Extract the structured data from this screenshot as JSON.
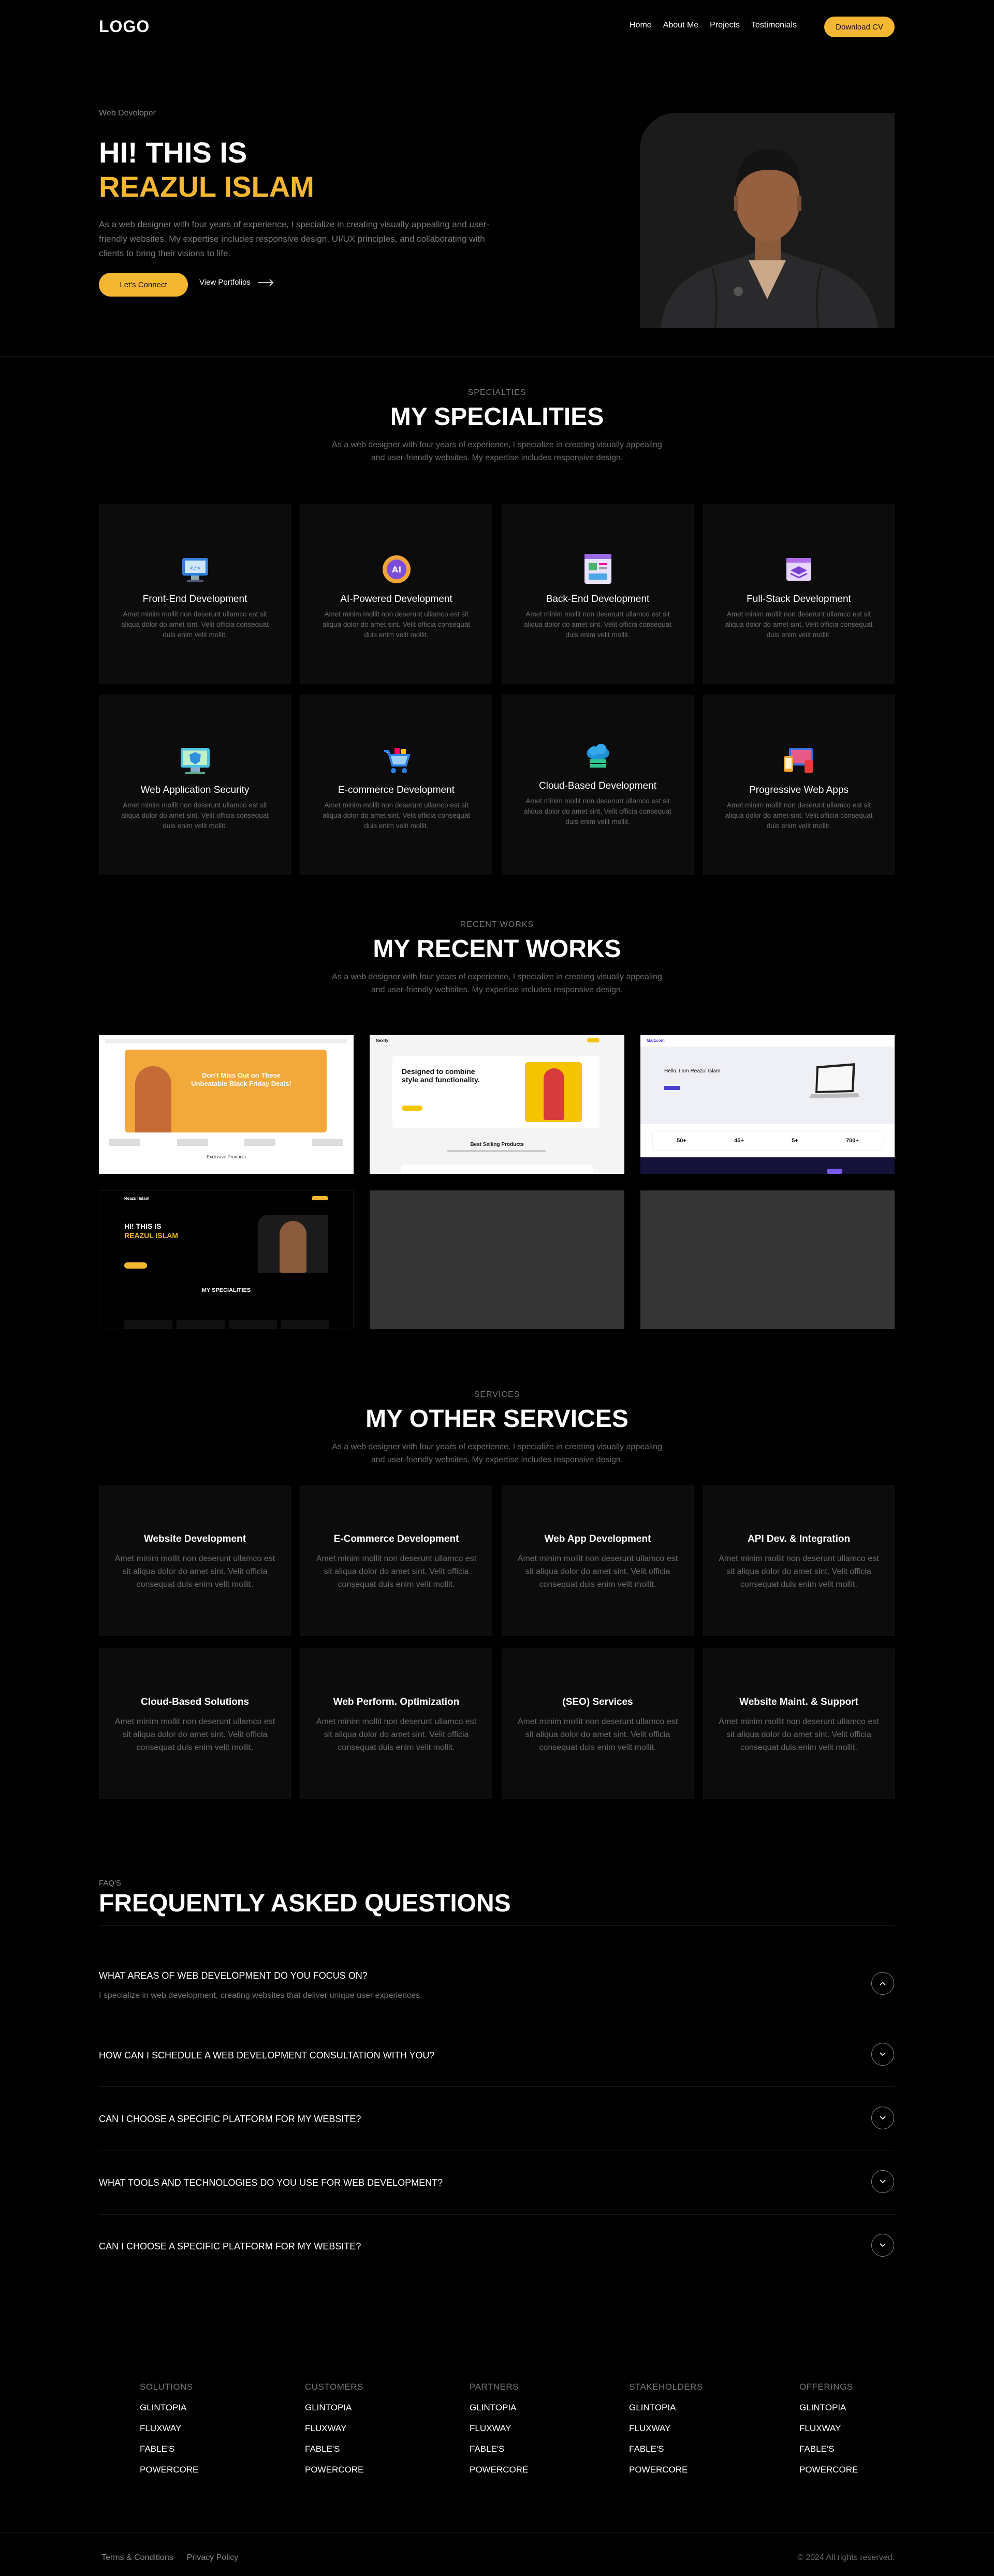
{
  "header": {
    "logo": "LOGO",
    "nav": [
      "Home",
      "About Me",
      "Projects",
      "Testimonials"
    ],
    "cta": "Download CV"
  },
  "hero": {
    "tag": "Web Developer",
    "line1": "HI! THIS IS",
    "line2": "REAZUL ISLAM",
    "desc": "As a web designer with four years of experience, I specialize in creating visually appealing and user-friendly websites. My expertise includes responsive design, UI/UX principles, and collaborating with clients to bring their visions to life.",
    "btn_connect": "Let's Connect",
    "btn_portfolio": "View Portfolios"
  },
  "specialities": {
    "tag": "SPECIALTIES",
    "title": "MY SPECIALITIES",
    "desc": "As a web designer with four years of experience, I specialize in creating visually appealing and user-friendly websites. My expertise includes responsive design.",
    "card_desc": "Amet minim mollit non deserunt ullamco est sit aliqua dolor do amet sint. Velit officia consequat duis enim velit mollit.",
    "items": [
      {
        "title": "Front-End Development",
        "icon": "monitor-code-icon"
      },
      {
        "title": "AI-Powered Development",
        "icon": "ai-chip-icon"
      },
      {
        "title": "Back-End Development",
        "icon": "server-window-icon"
      },
      {
        "title": "Full-Stack Development",
        "icon": "stack-window-icon"
      },
      {
        "title": "Web Application Security",
        "icon": "shield-monitor-icon"
      },
      {
        "title": "E-commerce Development",
        "icon": "shopping-cart-icon"
      },
      {
        "title": "Cloud-Based Development",
        "icon": "cloud-server-icon"
      },
      {
        "title": "Progressive Web Apps",
        "icon": "devices-icon"
      }
    ]
  },
  "works": {
    "tag": "RECENT WORKS",
    "title": "MY RECENT WORKS",
    "desc": "As a web designer with four years of experience, I specialize in creating visually appealing and user-friendly websites. My expertise includes responsive design.",
    "thumb1": {
      "headline": "Don't Miss Out on These Unbeatable Black Friday Deals!",
      "sub": "Exclusive Products"
    },
    "thumb2": {
      "brand": "Nexify",
      "headline": "Designed to combine style and functionality.",
      "sub": "Best Selling Products"
    },
    "thumb3": {
      "brand": "Marzcom",
      "headline": "Hello, I am Reazul Islam",
      "stats": [
        "50+",
        "45+",
        "5+",
        "700+"
      ]
    },
    "thumb4": {
      "brand": "Reazul Islam",
      "line1": "HI! THIS IS",
      "line2": "REAZUL ISLAM",
      "sub": "MY SPECIALITIES"
    }
  },
  "services": {
    "tag": "SERVICES",
    "title": "MY OTHER SERVICES",
    "desc": "As a web designer with four years of experience, I specialize in creating visually appealing and user-friendly websites. My expertise includes responsive design.",
    "card_desc": "Amet minim mollit non deserunt ullamco est sit aliqua dolor do amet sint. Velit officia consequat duis enim velit mollit.",
    "items": [
      "Website Development",
      "E-Commerce Development",
      "Web App Development",
      "API Dev. & Integration",
      "Cloud-Based Solutions",
      "Web Perform. Optimization",
      "(SEO) Services",
      "Website Maint. & Support"
    ]
  },
  "faq": {
    "tag": "FAQ'S",
    "title": "FREQUENTLY ASKED QUESTIONS",
    "items": [
      {
        "q": "WHAT AREAS OF WEB DEVELOPMENT DO YOU FOCUS ON?",
        "a": "I specialize in web development, creating websites that deliver unique user experiences.",
        "open": true
      },
      {
        "q": "HOW CAN I SCHEDULE A WEB DEVELOPMENT CONSULTATION WITH YOU?",
        "open": false
      },
      {
        "q": "CAN I CHOOSE A SPECIFIC PLATFORM FOR MY WEBSITE?",
        "open": false
      },
      {
        "q": "WHAT TOOLS AND TECHNOLOGIES DO YOU USE FOR WEB DEVELOPMENT?",
        "open": false
      },
      {
        "q": "CAN I CHOOSE A SPECIFIC PLATFORM FOR MY WEBSITE?",
        "open": false
      }
    ]
  },
  "footer": {
    "columns": [
      {
        "heading": "SOLUTIONS",
        "items": [
          "GLINTOPIA",
          "FLUXWAY",
          "FABLE'S",
          "POWERCORE"
        ]
      },
      {
        "heading": "CUSTOMERS",
        "items": [
          "GLINTOPIA",
          "FLUXWAY",
          "FABLE'S",
          "POWERCORE"
        ]
      },
      {
        "heading": "PARTNERS",
        "items": [
          "GLINTOPIA",
          "FLUXWAY",
          "FABLE'S",
          "POWERCORE"
        ]
      },
      {
        "heading": "STAKEHOLDERS",
        "items": [
          "GLINTOPIA",
          "FLUXWAY",
          "FABLE'S",
          "POWERCORE"
        ]
      },
      {
        "heading": "OFFERINGS",
        "items": [
          "GLINTOPIA",
          "FLUXWAY",
          "FABLE'S",
          "POWERCORE"
        ]
      }
    ],
    "terms": "Terms & Conditions",
    "privacy": "Privacy Policy",
    "copyright": "© 2024 All rights reserved."
  },
  "colors": {
    "accent": "#f5b731",
    "card": "#0c0c0c",
    "muted": "#6b6b6b"
  }
}
